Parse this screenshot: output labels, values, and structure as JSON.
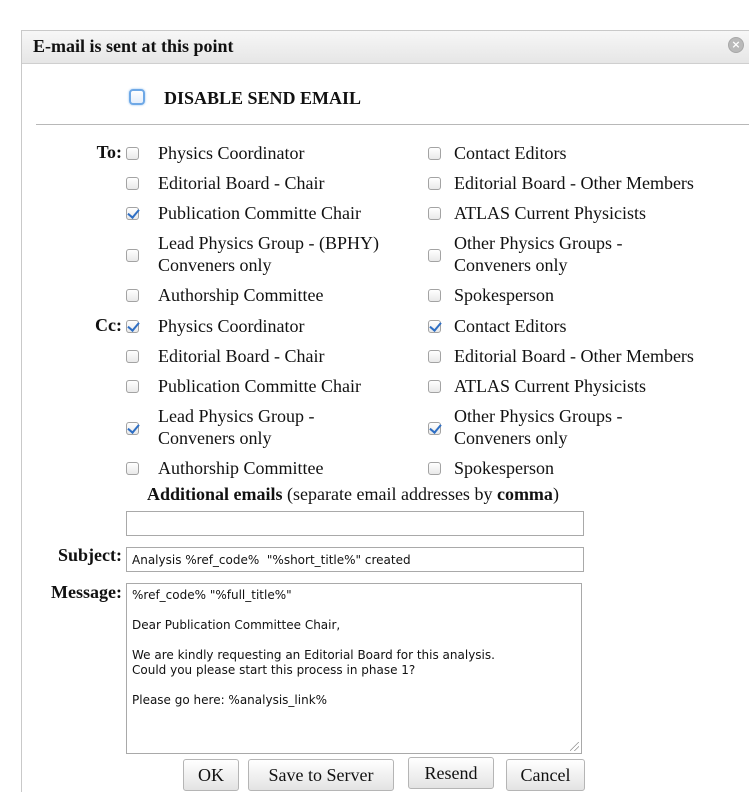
{
  "dialog": {
    "title": "E-mail is sent at this point",
    "close_icon": "close-circle-icon",
    "disable_send_email": "DISABLE SEND EMAIL"
  },
  "to": {
    "label": "To:",
    "left": [
      {
        "line1": "Physics Coordinator",
        "line2": "",
        "checked": false
      },
      {
        "line1": "Editorial Board - Chair",
        "line2": "",
        "checked": false
      },
      {
        "line1": "Publication Committe Chair",
        "line2": "",
        "checked": true
      },
      {
        "line1": "Lead Physics Group - (BPHY)",
        "line2": "Conveners only",
        "checked": false
      },
      {
        "line1": "Authorship Committee",
        "line2": "",
        "checked": false
      }
    ],
    "right": [
      {
        "line1": "Contact Editors",
        "line2": "",
        "checked": false
      },
      {
        "line1": "Editorial Board - Other Members",
        "line2": "",
        "checked": false
      },
      {
        "line1": "ATLAS Current Physicists",
        "line2": "",
        "checked": false
      },
      {
        "line1": "Other Physics Groups -",
        "line2": "Conveners only",
        "checked": false
      },
      {
        "line1": "Spokesperson",
        "line2": "",
        "checked": false
      }
    ]
  },
  "cc": {
    "label": "Cc:",
    "left": [
      {
        "line1": "Physics Coordinator",
        "line2": "",
        "checked": true
      },
      {
        "line1": "Editorial Board - Chair",
        "line2": "",
        "checked": false
      },
      {
        "line1": "Publication Committe Chair",
        "line2": "",
        "checked": false
      },
      {
        "line1": "Lead Physics Group -",
        "line2": "Conveners only",
        "checked": true
      },
      {
        "line1": "Authorship Committee",
        "line2": "",
        "checked": false
      }
    ],
    "right": [
      {
        "line1": "Contact Editors",
        "line2": "",
        "checked": true
      },
      {
        "line1": "Editorial Board - Other Members",
        "line2": "",
        "checked": false
      },
      {
        "line1": "ATLAS Current Physicists",
        "line2": "",
        "checked": false
      },
      {
        "line1": "Other Physics Groups -",
        "line2": "Conveners only",
        "checked": true
      },
      {
        "line1": "Spokesperson",
        "line2": "",
        "checked": false
      }
    ]
  },
  "additional": {
    "bold": "Additional emails",
    "middle": " (separate email addresses by ",
    "bold2": "comma",
    "end": ")",
    "value": ""
  },
  "subject": {
    "label": "Subject:",
    "value": "Analysis %ref_code%  \"%short_title%\" created"
  },
  "message": {
    "label": "Message:",
    "value": "%ref_code% \"%full_title%\"\n\nDear Publication Committee Chair,\n\nWe are kindly requesting an Editorial Board for this analysis.\nCould you please start this process in phase 1?\n\nPlease go here: %analysis_link%"
  },
  "buttons": {
    "ok": "OK",
    "save": "Save to Server",
    "resend": "Resend",
    "cancel": "Cancel"
  }
}
